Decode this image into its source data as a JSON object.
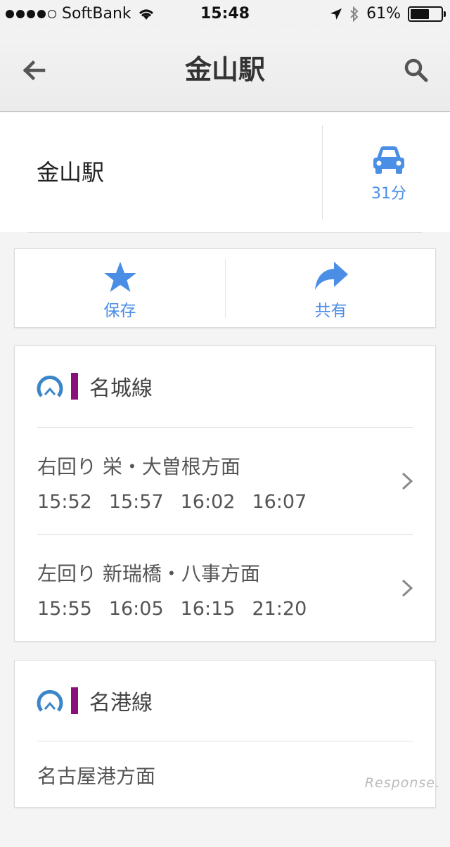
{
  "status": {
    "carrier": "SoftBank",
    "time": "15:48",
    "battery": "61%",
    "battery_level": 0.61
  },
  "nav": {
    "title": "金山駅",
    "back_icon": "back-arrow-icon",
    "search_icon": "search-icon"
  },
  "place": {
    "name": "金山駅",
    "drive_time": "31分"
  },
  "actions": {
    "save_label": "保存",
    "share_label": "共有"
  },
  "lines": [
    {
      "name": "名城線",
      "color": "#8b0f7a",
      "directions": [
        {
          "name": "右回り 栄・大曽根方面",
          "times": [
            "15:52",
            "15:57",
            "16:02",
            "16:07"
          ]
        },
        {
          "name": "左回り 新瑞橋・八事方面",
          "times": [
            "15:55",
            "16:05",
            "16:15",
            "21:20"
          ]
        }
      ]
    },
    {
      "name": "名港線",
      "color": "#8b0f7a",
      "directions": [
        {
          "name": "名古屋港方面",
          "times": []
        }
      ]
    }
  ],
  "watermark": "Response.",
  "colors": {
    "accent": "#4a8ee6",
    "line": "#8b0f7a",
    "logo": "#3a86c8"
  }
}
